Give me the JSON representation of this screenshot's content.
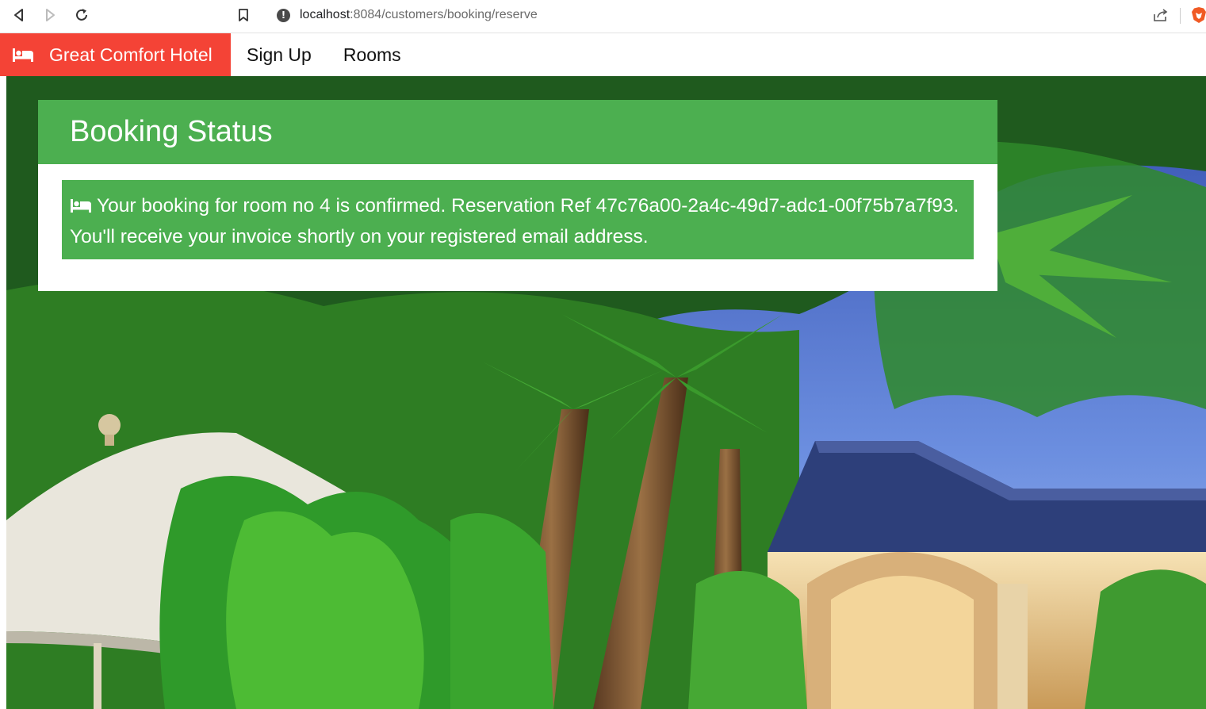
{
  "browser": {
    "url_host": "localhost",
    "url_path": ":8084/customers/booking/reserve",
    "nav_icons": [
      "back-icon",
      "forward-icon",
      "reload-icon",
      "bookmark-icon",
      "share-icon",
      "brave-lion-icon"
    ]
  },
  "navbar": {
    "brand_label": "Great Comfort Hotel",
    "brand_icon": "bed-icon",
    "links": [
      {
        "label": "Sign Up"
      },
      {
        "label": "Rooms"
      }
    ]
  },
  "booking_status": {
    "title": "Booking Status",
    "alert_icon": "bed-icon",
    "message": "Your booking for room no 4 is confirmed. Reservation Ref 47c76a00-2a4c-49d7-adc1-00f75b7a7f93. You'll receive your invoice shortly on your registered email address."
  },
  "colors": {
    "brand": "#f44336",
    "success": "#4caf50",
    "text_dark": "#111111",
    "white": "#ffffff"
  }
}
